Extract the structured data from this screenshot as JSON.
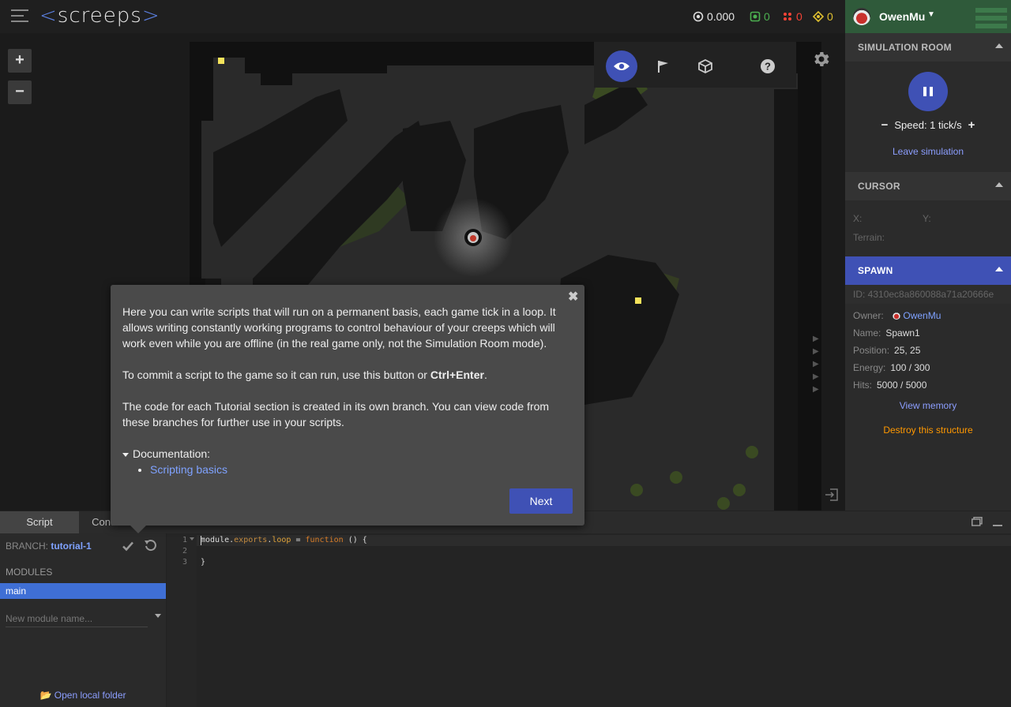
{
  "header": {
    "logo": {
      "text": "screeps",
      "open": "<",
      "close": ">"
    },
    "stats": [
      {
        "icon": "cpu-icon",
        "value": "0.000",
        "color": "#e6e6e6"
      },
      {
        "icon": "gcl-icon",
        "value": "0",
        "color": "#4caf50"
      },
      {
        "icon": "power-icon",
        "value": "0",
        "color": "#f44336"
      },
      {
        "icon": "credits-icon",
        "value": "0",
        "color": "#e0c030"
      }
    ],
    "username": "OwenMu"
  },
  "map": {
    "zoom_in": "+",
    "zoom_out": "−",
    "toolbar": [
      "view-icon",
      "flag-icon",
      "cube-icon",
      "help-icon"
    ]
  },
  "right_panel": {
    "simulation": {
      "title": "SIMULATION ROOM",
      "speed_label": "Speed: 1 tick/s",
      "leave": "Leave simulation"
    },
    "cursor": {
      "title": "CURSOR",
      "x_label": "X:",
      "y_label": "Y:",
      "terrain_label": "Terrain:"
    },
    "spawn": {
      "title": "SPAWN",
      "id": "ID: 4310ec8a860088a71a20666e",
      "owner_label": "Owner:",
      "owner": "OwenMu",
      "name_label": "Name:",
      "name": "Spawn1",
      "position_label": "Position:",
      "position": "25, 25",
      "energy_label": "Energy:",
      "energy": "100 / 300",
      "hits_label": "Hits:",
      "hits": "5000 / 5000",
      "view_memory": "View memory",
      "destroy": "Destroy this structure"
    }
  },
  "bottom": {
    "tabs": [
      "Script",
      "Console"
    ],
    "branch_label": "BRANCH:",
    "branch": "tutorial-1",
    "modules_title": "MODULES",
    "module_active": "main",
    "new_module_placeholder": "New module name...",
    "open_folder": "Open local folder",
    "line_numbers": [
      "1",
      "2",
      "3"
    ],
    "code": {
      "l1_mod": "module.",
      "l1_exports": "exports",
      "l1_dot": ".",
      "l1_loop": "loop",
      "l1_eq": " = ",
      "l1_fn": "function",
      "l1_rest": " () {",
      "l3": "}"
    }
  },
  "popup": {
    "p1": "Here you can write scripts that will run on a permanent basis, each game tick in a loop. It allows writing constantly working programs to control behaviour of your creeps which will work even while you are offline (in the real game only, not the Simulation Room mode).",
    "p2_before": "To commit a script to the game so it can run, use this button or ",
    "p2_bold": "Ctrl+Enter",
    "p2_after": ".",
    "p3": "The code for each Tutorial section is created in its own branch. You can view code from these branches for further use in your scripts.",
    "doc_title": "Documentation:",
    "doc_link": "Scripting basics",
    "next": "Next"
  }
}
